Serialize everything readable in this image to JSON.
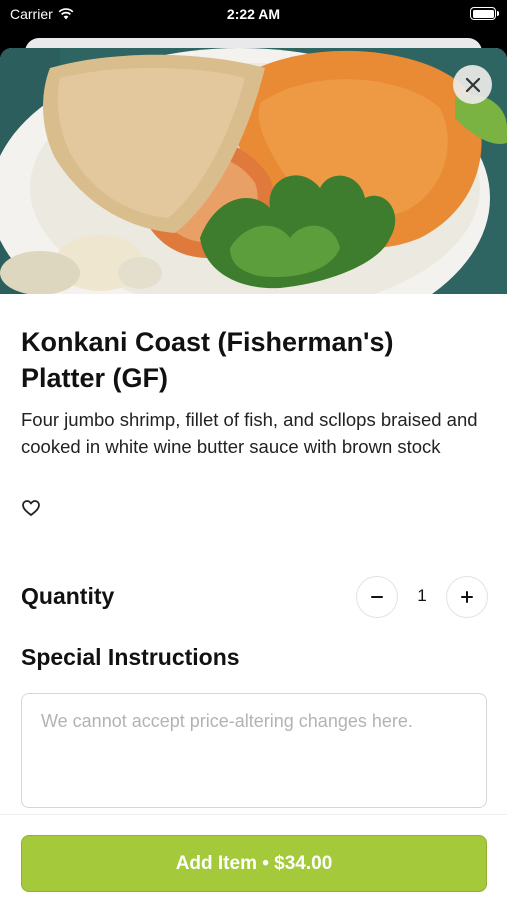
{
  "status_bar": {
    "carrier": "Carrier",
    "time": "2:22 AM",
    "wifi_icon": "wifi-icon",
    "battery_icon": "battery-icon"
  },
  "item": {
    "image_icon": "food-photo",
    "name": "Konkani Coast (Fisherman's) Platter (GF)",
    "description": "Four jumbo shrimp, fillet of fish, and scllops braised and cooked in white wine butter sauce with brown stock",
    "favorite_icon": "heart-outline-icon"
  },
  "close": {
    "icon": "close-icon"
  },
  "quantity": {
    "label": "Quantity",
    "value": "1",
    "decrement_icon": "minus-icon",
    "increment_icon": "plus-icon"
  },
  "instructions": {
    "label": "Special Instructions",
    "placeholder": "We cannot accept price-altering changes here.",
    "value": ""
  },
  "footer": {
    "add_button_label": "Add Item • $34.00"
  },
  "colors": {
    "accent": "#a4c93b",
    "background": "#ffffff",
    "text": "#111111"
  }
}
